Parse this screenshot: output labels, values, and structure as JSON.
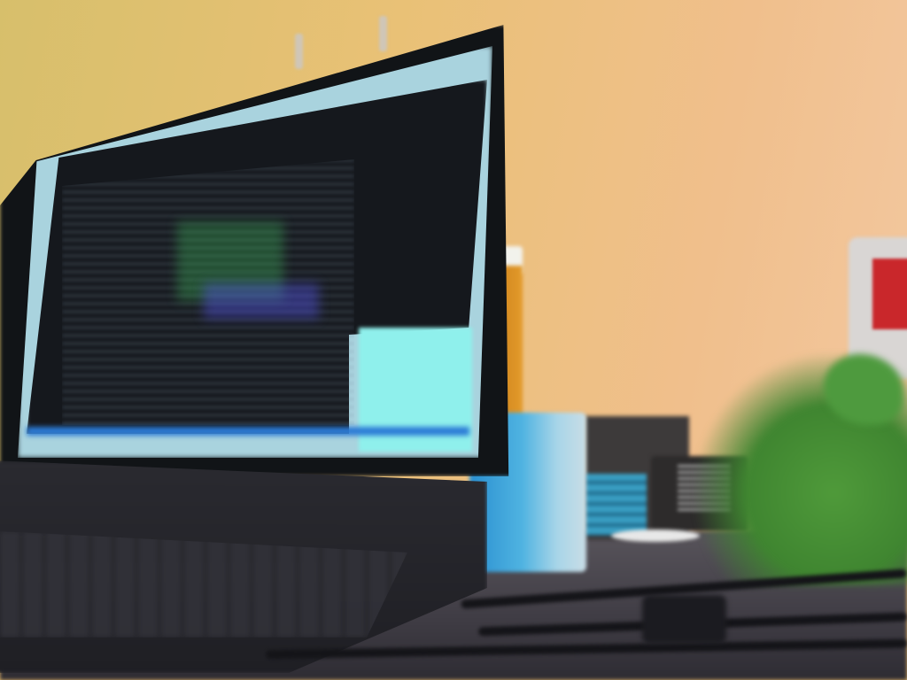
{
  "colors": {
    "wall": "#e9c176",
    "desk": "#4a474f",
    "laptop": "#111417",
    "screen_cyan": "#8ff0ec",
    "mug": "#4fb3e1",
    "bottle": "#e39a2a",
    "jug_label": "#c9272b",
    "plant": "#4f9a3a"
  }
}
